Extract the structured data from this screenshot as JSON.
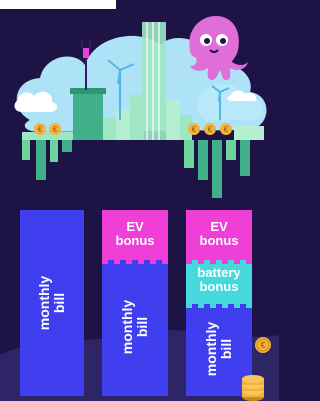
{
  "columns": [
    {
      "segments": {
        "bill": "monthly\nbill"
      }
    },
    {
      "segments": {
        "bill": "monthly\nbill",
        "ev": "EV\nbonus"
      }
    },
    {
      "segments": {
        "bill": "monthly\nbill",
        "ev": "EV\nbonus",
        "battery": "battery\nbonus"
      }
    }
  ],
  "colors": {
    "background": "#1d1445",
    "bill": "#3f3ff0",
    "ev_bonus": "#ef3fd6",
    "battery_bonus": "#45d8dc",
    "coin": "#f2b23b"
  },
  "icons": [
    "plug-icon",
    "octopus-icon",
    "wind-turbine-icon",
    "coin-icon"
  ]
}
